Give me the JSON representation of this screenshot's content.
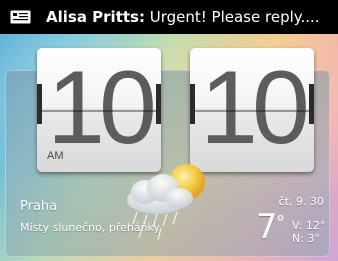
{
  "notification": {
    "icon": "mail-icon",
    "sender": "Alisa Pritts:",
    "message": "Urgent! Please reply...."
  },
  "clock": {
    "hours": "10",
    "minutes": "10",
    "ampm": "AM"
  },
  "weather": {
    "city": "Praha",
    "condition": "Místy slunečno, přeháňky",
    "date": "čt, 9. 30",
    "temperature": "7",
    "degree_symbol": "°",
    "high": "V: 12°",
    "low": "N:   3°",
    "icon": "partly-sunny-showers-icon"
  }
}
